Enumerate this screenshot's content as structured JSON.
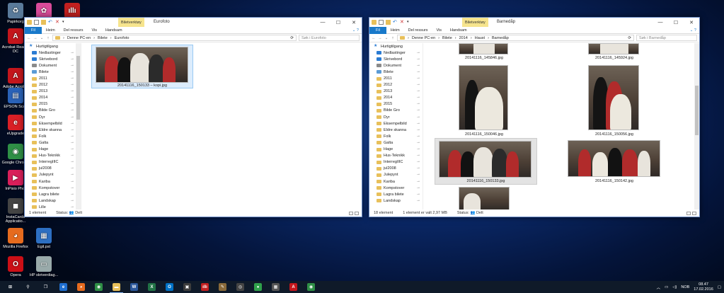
{
  "desktop_icons": [
    {
      "name": "recycle-bin",
      "label": "Papirkorg",
      "color": "#5a7a9a",
      "glyph": "♻"
    },
    {
      "name": "picasa",
      "label": "Picasa 3",
      "color": "#d94b9a",
      "glyph": "✿"
    },
    {
      "name": "imgcmd",
      "label": "IMGCMD",
      "color": "#c21f1f",
      "glyph": "ıllı"
    },
    {
      "name": "acrobat-reader",
      "label": "Acrobat Reader DC",
      "color": "#c4161c",
      "glyph": "A"
    },
    {
      "name": "adobe-acrobat",
      "label": "Adobe Acrobat DC",
      "color": "#c4161c",
      "glyph": "A"
    },
    {
      "name": "epson-scan",
      "label": "EPSON Scan",
      "color": "#2a62b8",
      "glyph": "▤"
    },
    {
      "name": "eupgrade",
      "label": "eUpgrade",
      "color": "#d91f26",
      "glyph": "e"
    },
    {
      "name": "google-chrome",
      "label": "Google Chrome",
      "color": "#2f8f46",
      "glyph": "◉"
    },
    {
      "name": "inpixio",
      "label": "InPixio Phot",
      "color": "#d91f5a",
      "glyph": "▶"
    },
    {
      "name": "instacards",
      "label": "InstaCards Applicatio...",
      "color": "#444",
      "glyph": "◼"
    },
    {
      "name": "firefox",
      "label": "Mozilla Firefox",
      "color": "#e66b1e",
      "glyph": "◕"
    },
    {
      "name": "egil-pst",
      "label": "Egil.pst",
      "color": "#2d6fc2",
      "glyph": "▦"
    },
    {
      "name": "opera",
      "label": "Opera",
      "color": "#cc0f16",
      "glyph": "O"
    },
    {
      "name": "hp-printer",
      "label": "HP skriverdiag...",
      "color": "#9aa",
      "glyph": "▭"
    }
  ],
  "left_window": {
    "tool_tab": "Biletverktøy",
    "title": "Eurofoto",
    "ribbon_tabs": [
      "Fil",
      "Heim",
      "Del ressurs",
      "Vis",
      "Handsam"
    ],
    "breadcrumb": [
      "Denne PC-en",
      "Bilete",
      "Eurofoto"
    ],
    "search_placeholder": "Søk i Eurofoto",
    "nav_items": [
      {
        "label": "Hurtigtilgang",
        "icon": "star",
        "color": "#2b7cd3"
      },
      {
        "label": "Nedlastinger",
        "icon": "download",
        "color": "#2b7cd3"
      },
      {
        "label": "Skrivebord",
        "icon": "desktop",
        "color": "#2b7cd3"
      },
      {
        "label": "Dokument",
        "icon": "document",
        "color": "#8a8a8a"
      },
      {
        "label": "Bilete",
        "icon": "pictures",
        "color": "#5b9bd5"
      },
      {
        "label": "2011",
        "icon": "folder",
        "color": "#e8c05a"
      },
      {
        "label": "2012",
        "icon": "folder",
        "color": "#e8c05a"
      },
      {
        "label": "2013",
        "icon": "folder",
        "color": "#e8c05a"
      },
      {
        "label": "2014",
        "icon": "folder",
        "color": "#e8c05a"
      },
      {
        "label": "2015",
        "icon": "folder",
        "color": "#e8c05a"
      },
      {
        "label": "Bilde Gro",
        "icon": "folder",
        "color": "#e8c05a"
      },
      {
        "label": "Dyr",
        "icon": "folder",
        "color": "#e8c05a"
      },
      {
        "label": "Eksempelbild",
        "icon": "folder",
        "color": "#e8c05a"
      },
      {
        "label": "Eldre skanna",
        "icon": "folder",
        "color": "#e8c05a"
      },
      {
        "label": "Folk",
        "icon": "folder",
        "color": "#e8c05a"
      },
      {
        "label": "Galta",
        "icon": "folder",
        "color": "#e8c05a"
      },
      {
        "label": "Hage",
        "icon": "folder",
        "color": "#e8c05a"
      },
      {
        "label": "Hus-Teknikk",
        "icon": "folder",
        "color": "#e8c05a"
      },
      {
        "label": "InterregIIIC",
        "icon": "folder",
        "color": "#e8c05a"
      },
      {
        "label": "jul2008",
        "icon": "folder",
        "color": "#e8c05a"
      },
      {
        "label": "Julepynt",
        "icon": "folder",
        "color": "#e8c05a"
      },
      {
        "label": "Kariba",
        "icon": "folder",
        "color": "#e8c05a"
      },
      {
        "label": "Kompstover",
        "icon": "folder",
        "color": "#e8c05a"
      },
      {
        "label": "Lagra bilete",
        "icon": "folder",
        "color": "#e8c05a"
      },
      {
        "label": "Landskap",
        "icon": "folder",
        "color": "#e8c05a"
      },
      {
        "label": "Lille",
        "icon": "folder",
        "color": "#e8c05a"
      }
    ],
    "files": [
      {
        "name": "20141116_150133 – kopi.jpg",
        "selected": true
      }
    ],
    "status": {
      "count": "1 element",
      "state": "Status:",
      "shared": "Delt"
    }
  },
  "right_window": {
    "tool_tab": "Biletverktøy",
    "title": "Barnedåp",
    "ribbon_tabs": [
      "Fil",
      "Heim",
      "Del ressurs",
      "Vis",
      "Handsam"
    ],
    "breadcrumb": [
      "Denne PC-en",
      "Bilete",
      "2014",
      "Haust",
      "Barnedåp"
    ],
    "search_placeholder": "Søk i Barnedåp",
    "nav_items": [
      {
        "label": "Hurtigtilgang",
        "icon": "star",
        "color": "#2b7cd3"
      },
      {
        "label": "Nedlastinger",
        "icon": "download",
        "color": "#2b7cd3"
      },
      {
        "label": "Skrivebord",
        "icon": "desktop",
        "color": "#2b7cd3"
      },
      {
        "label": "Dokument",
        "icon": "document",
        "color": "#8a8a8a"
      },
      {
        "label": "Bilete",
        "icon": "pictures",
        "color": "#5b9bd5"
      },
      {
        "label": "2011",
        "icon": "folder",
        "color": "#e8c05a"
      },
      {
        "label": "2012",
        "icon": "folder",
        "color": "#e8c05a"
      },
      {
        "label": "2013",
        "icon": "folder",
        "color": "#e8c05a"
      },
      {
        "label": "2014",
        "icon": "folder",
        "color": "#e8c05a"
      },
      {
        "label": "2015",
        "icon": "folder",
        "color": "#e8c05a"
      },
      {
        "label": "Bilde Gro",
        "icon": "folder",
        "color": "#e8c05a"
      },
      {
        "label": "Dyr",
        "icon": "folder",
        "color": "#e8c05a"
      },
      {
        "label": "Eksempelbild",
        "icon": "folder",
        "color": "#e8c05a"
      },
      {
        "label": "Eldre skanna",
        "icon": "folder",
        "color": "#e8c05a"
      },
      {
        "label": "Folk",
        "icon": "folder",
        "color": "#e8c05a"
      },
      {
        "label": "Galta",
        "icon": "folder",
        "color": "#e8c05a"
      },
      {
        "label": "Hage",
        "icon": "folder",
        "color": "#e8c05a"
      },
      {
        "label": "Hus-Teknikk",
        "icon": "folder",
        "color": "#e8c05a"
      },
      {
        "label": "InterregIIIC",
        "icon": "folder",
        "color": "#e8c05a"
      },
      {
        "label": "jul2008",
        "icon": "folder",
        "color": "#e8c05a"
      },
      {
        "label": "Julepynt",
        "icon": "folder",
        "color": "#e8c05a"
      },
      {
        "label": "Kariba",
        "icon": "folder",
        "color": "#e8c05a"
      },
      {
        "label": "Kompstover",
        "icon": "folder",
        "color": "#e8c05a"
      },
      {
        "label": "Lagra bilete",
        "icon": "folder",
        "color": "#e8c05a"
      },
      {
        "label": "Landskap",
        "icon": "folder",
        "color": "#e8c05a"
      }
    ],
    "files": [
      {
        "name": "20141116_145846.jpg"
      },
      {
        "name": "20141116_145924.jpg"
      },
      {
        "name": "20141116_150046.jpg"
      },
      {
        "name": "20141116_150056.jpg"
      },
      {
        "name": "20141116_150133.jpg",
        "selected": true
      },
      {
        "name": "20141116_150142.jpg"
      }
    ],
    "status": {
      "count": "18 element",
      "selection": "1 element er valt 2,97 MB",
      "state": "Status:",
      "shared": "Delt"
    }
  },
  "taskbar": {
    "icons": [
      {
        "name": "start-icon",
        "glyph": "⊞",
        "color": "transparent"
      },
      {
        "name": "search-icon",
        "glyph": "⚲",
        "color": "transparent"
      },
      {
        "name": "task-view-icon",
        "glyph": "❐",
        "color": "transparent"
      },
      {
        "name": "edge-icon",
        "glyph": "e",
        "color": "#1f6fd0"
      },
      {
        "name": "firefox-icon",
        "glyph": "◕",
        "color": "#e66b1e"
      },
      {
        "name": "chrome-icon",
        "glyph": "◉",
        "color": "#2f8f46"
      },
      {
        "name": "file-explorer-icon",
        "glyph": "▬",
        "color": "#e8c05a",
        "active": true
      },
      {
        "name": "word-icon",
        "glyph": "W",
        "color": "#2b579a"
      },
      {
        "name": "excel-icon",
        "glyph": "X",
        "color": "#217346"
      },
      {
        "name": "outlook-icon",
        "glyph": "O",
        "color": "#0072c6"
      },
      {
        "name": "store-icon",
        "glyph": "▣",
        "color": "#3c3c3c"
      },
      {
        "name": "imgcmd-taskbar-icon",
        "glyph": "ıllı",
        "color": "#c21f1f"
      },
      {
        "name": "picture-editor-icon",
        "glyph": "✎",
        "color": "#8a6a3a"
      },
      {
        "name": "camera-app-icon",
        "glyph": "◎",
        "color": "#444"
      },
      {
        "name": "green-app-icon",
        "glyph": "●",
        "color": "#2fa04a"
      },
      {
        "name": "calendar-icon",
        "glyph": "▦",
        "color": "#555"
      },
      {
        "name": "acrobat-taskbar-icon",
        "glyph": "A",
        "color": "#c4161c"
      },
      {
        "name": "chrome-taskbar-icon",
        "glyph": "◉",
        "color": "#2f8f46"
      }
    ],
    "language": "NOB",
    "time": "08.47",
    "date": "17.02.2016"
  }
}
